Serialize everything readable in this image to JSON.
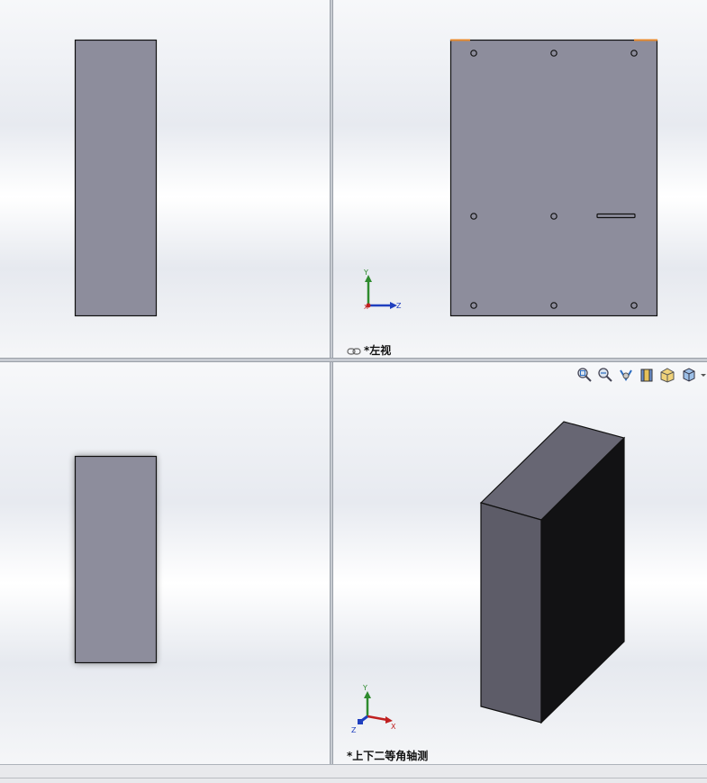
{
  "viewports": {
    "top_right": {
      "label": "*左视"
    },
    "bottom_right": {
      "label": "*上下二等角轴测"
    }
  },
  "triad": {
    "y": "Y",
    "z": "Z",
    "x": "X"
  },
  "toolbar": {
    "icons": [
      "zoom-to-fit-icon",
      "zoom-area-icon",
      "previous-view-icon",
      "section-view-icon",
      "view-orientation-icon",
      "display-style-icon",
      "dropdown-arrow-icon"
    ]
  },
  "colors": {
    "part_face": "#8d8d9c",
    "iso_front": "#5d5c68",
    "iso_top": "#676673",
    "iso_side": "#121214",
    "edge_highlight": "#e8892a",
    "axis_y": "#2e8b2e",
    "axis_z": "#1f3fbf",
    "axis_x": "#c02020"
  }
}
